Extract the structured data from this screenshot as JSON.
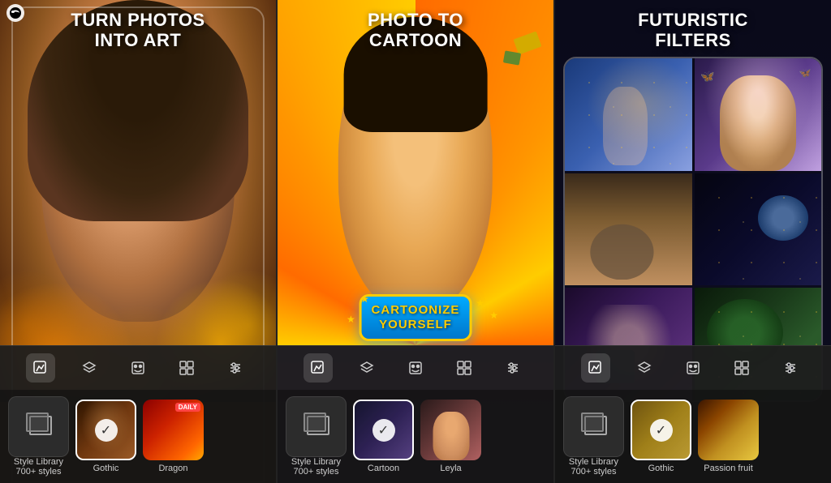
{
  "app": {
    "logo": "oculus-logo"
  },
  "panel1": {
    "title_line1": "TURN PHOTOS",
    "title_line2": "INTO ART",
    "toolbar_icons": [
      {
        "name": "edit-icon",
        "symbol": "✎",
        "active": true
      },
      {
        "name": "layers-icon",
        "symbol": "⊞",
        "active": false
      },
      {
        "name": "face-icon",
        "symbol": "⊡",
        "active": false
      },
      {
        "name": "collage-icon",
        "symbol": "⊟",
        "active": false
      },
      {
        "name": "adjust-icon",
        "symbol": "⚙",
        "active": false
      }
    ],
    "style_items": [
      {
        "id": "style-library",
        "label": "Style Library",
        "sublabel": "700+ styles",
        "type": "library"
      },
      {
        "id": "gothic",
        "label": "Gothic",
        "type": "style",
        "selected": true
      },
      {
        "id": "dragon",
        "label": "Dragon",
        "type": "style",
        "daily": true,
        "selected": false
      }
    ]
  },
  "panel2": {
    "title_line1": "PHOTO TO",
    "title_line2": "CARTOON",
    "bubble_text_line1": "CARTOONIZE",
    "bubble_text_line2": "YOURSELF",
    "toolbar_icons": [
      {
        "name": "edit-icon",
        "symbol": "✎",
        "active": true
      },
      {
        "name": "layers-icon",
        "symbol": "⊞",
        "active": false
      },
      {
        "name": "face-icon",
        "symbol": "⊡",
        "active": false
      },
      {
        "name": "collage-icon",
        "symbol": "⊟",
        "active": false
      },
      {
        "name": "adjust-icon",
        "symbol": "⚙",
        "active": false
      }
    ],
    "style_items": [
      {
        "id": "style-library",
        "label": "Style Library",
        "sublabel": "700+ styles",
        "type": "library"
      },
      {
        "id": "cartoon",
        "label": "Cartoon",
        "type": "style",
        "selected": true
      },
      {
        "id": "leyla",
        "label": "Leyla",
        "type": "style",
        "selected": false
      }
    ]
  },
  "panel3": {
    "title_line1": "FUTURISTIC",
    "title_line2": "FILTERS",
    "toolbar_icons": [
      {
        "name": "edit-icon",
        "symbol": "✎",
        "active": true
      },
      {
        "name": "layers-icon",
        "symbol": "⊞",
        "active": false
      },
      {
        "name": "face-icon",
        "symbol": "⊡",
        "active": false
      },
      {
        "name": "collage-icon",
        "symbol": "⊟",
        "active": false
      },
      {
        "name": "adjust-icon",
        "symbol": "⚙",
        "active": false
      }
    ],
    "style_items": [
      {
        "id": "style-library",
        "label": "Style Library",
        "sublabel": "700+ styles",
        "type": "library"
      },
      {
        "id": "gothic",
        "label": "Gothic",
        "type": "style",
        "selected": true
      },
      {
        "id": "passion-fruit",
        "label": "Passion fruit",
        "type": "style",
        "selected": false
      }
    ]
  }
}
